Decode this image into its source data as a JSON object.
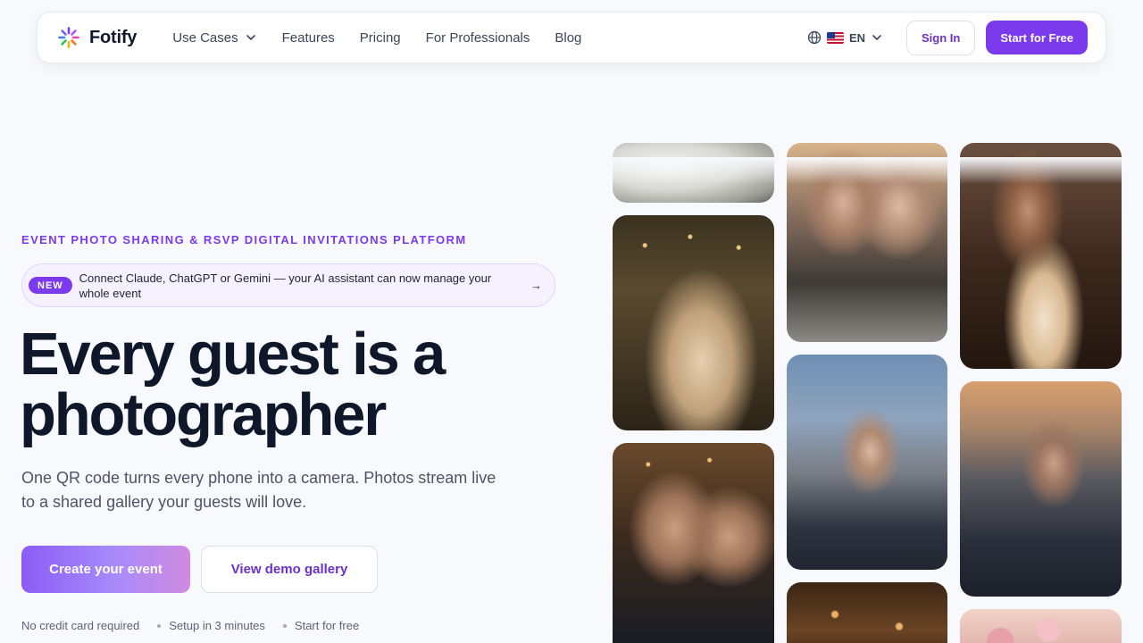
{
  "brand": {
    "name": "Fotify"
  },
  "nav": {
    "links": [
      {
        "label": "Use Cases",
        "has_dropdown": true
      },
      {
        "label": "Features"
      },
      {
        "label": "Pricing"
      },
      {
        "label": "For Professionals"
      },
      {
        "label": "Blog"
      }
    ],
    "language": {
      "code": "EN",
      "flag": "us-flag"
    },
    "sign_in": "Sign In",
    "start_free": "Start for Free"
  },
  "hero": {
    "eyebrow": "EVENT PHOTO SHARING & RSVP DIGITAL INVITATIONS PLATFORM",
    "announcement": {
      "badge": "NEW",
      "text": "Connect Claude, ChatGPT or Gemini — your AI assistant can now manage your whole event",
      "arrow": "→"
    },
    "headline": "Every guest is a photographer",
    "subtitle": "One QR code turns every phone into a camera. Photos stream live to a shared gallery your guests will love.",
    "primary_cta": "Create your event",
    "secondary_cta": "View demo gallery",
    "perks": [
      "No credit card required",
      "Setup in 3 minutes",
      "Start for free"
    ]
  },
  "gallery": {
    "photos": [
      "wedding-dress-detail",
      "wedding-dance",
      "grooms-embrace",
      "friends-laughing",
      "rooftop-dancer",
      "candlelit-dinner",
      "birthday-cake",
      "rooftop-cocktail-party",
      "balloon-decor"
    ]
  },
  "colors": {
    "accent": "#7c3aed",
    "background": "#f8f9fc",
    "text": "#0f172a"
  }
}
